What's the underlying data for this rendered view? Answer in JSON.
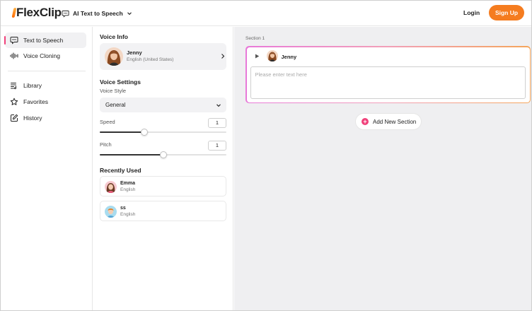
{
  "header": {
    "logo": "FlexClip",
    "tool": "AI Text to Speech",
    "login": "Login",
    "signup": "Sign Up"
  },
  "nav": {
    "items": [
      {
        "label": "Text to Speech",
        "icon": "speech-bubble-icon",
        "active": true
      },
      {
        "label": "Voice Cloning",
        "icon": "waveform-icon"
      },
      {
        "label": "Library",
        "icon": "library-icon"
      },
      {
        "label": "Favorites",
        "icon": "star-icon"
      },
      {
        "label": "History",
        "icon": "edit-icon"
      }
    ]
  },
  "voice_info": {
    "title": "Voice Info",
    "name": "Jenny",
    "language": "English (United States)"
  },
  "voice_settings": {
    "title": "Voice Settings",
    "style_label": "Voice Style",
    "style_value": "General",
    "speed_label": "Speed",
    "speed_value": "1",
    "speed_fraction": 0.35,
    "pitch_label": "Pitch",
    "pitch_value": "1",
    "pitch_fraction": 0.5
  },
  "recently_used": {
    "title": "Recently Used",
    "items": [
      {
        "name": "Emma",
        "language": "English"
      },
      {
        "name": "ss",
        "language": "English"
      }
    ]
  },
  "editor": {
    "section_label": "Section 1",
    "voice_name": "Jenny",
    "placeholder": "Please enter text here",
    "add_section": "Add New Section"
  },
  "colors": {
    "accent": "#f57c1f",
    "pink": "#f0407a"
  }
}
